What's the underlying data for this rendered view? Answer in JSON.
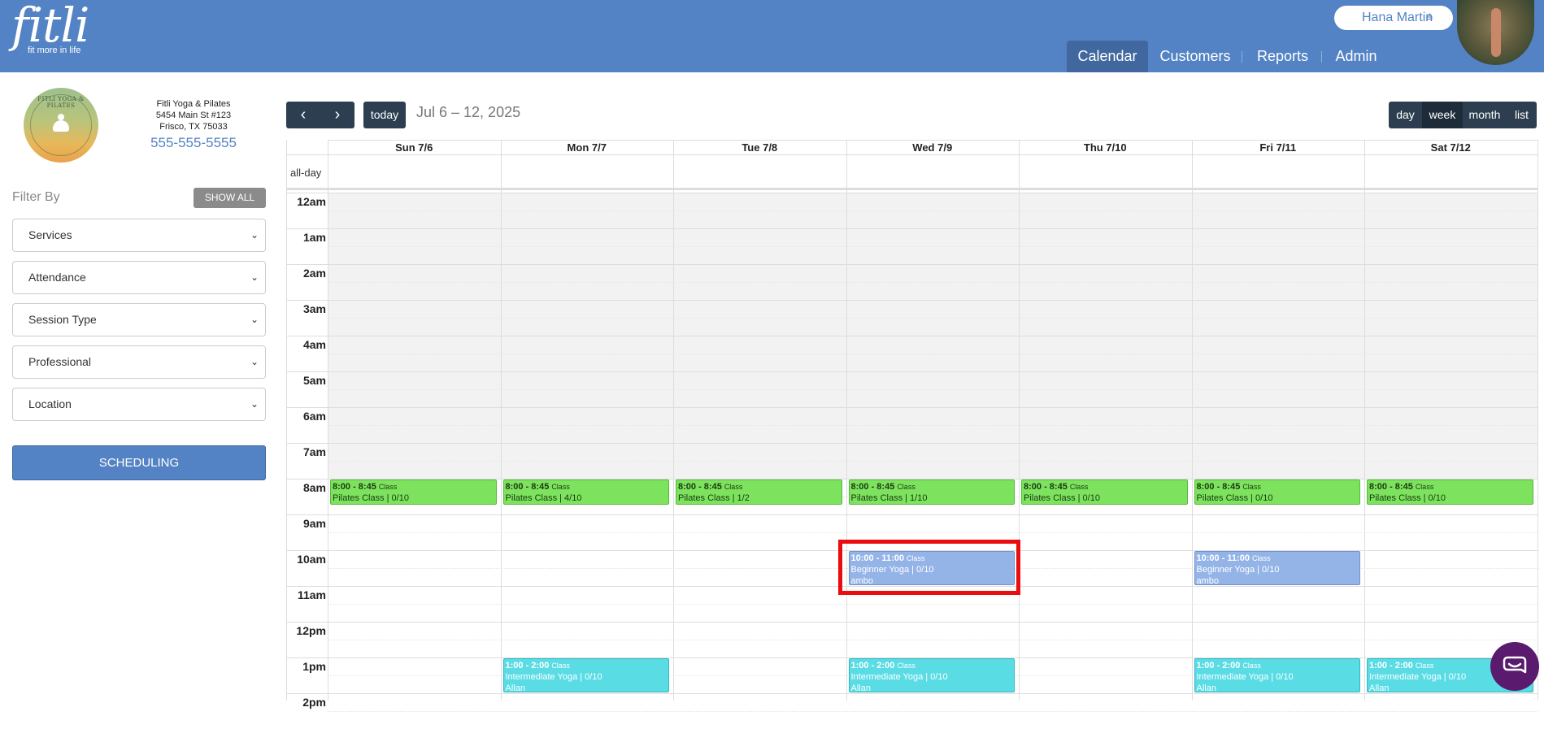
{
  "header": {
    "logo_word": "fitli",
    "logo_tagline": "fit more in life",
    "user_name": "Hana Martin",
    "nav": [
      "Calendar",
      "Customers",
      "Reports",
      "Admin"
    ]
  },
  "business": {
    "logo_text": "FITLI YOGA & PILATES",
    "name": "Fitli Yoga & Pilates",
    "address1": "5454 Main St #123",
    "address2": "Frisco, TX 75033",
    "phone": "555-555-5555"
  },
  "filters": {
    "label": "Filter By",
    "show_all": "SHOW ALL",
    "selects": [
      "Services",
      "Attendance",
      "Session Type",
      "Professional",
      "Location"
    ],
    "scheduling": "SCHEDULING"
  },
  "toolbar": {
    "prev": "‹",
    "next": "›",
    "today": "today",
    "date_range": "Jul 6 – 12, 2025",
    "views": [
      "day",
      "week",
      "month",
      "list"
    ]
  },
  "calendar": {
    "allday_label": "all-day",
    "days": [
      "Sun 7/6",
      "Mon 7/7",
      "Tue 7/8",
      "Wed 7/9",
      "Thu 7/10",
      "Fri 7/11",
      "Sat 7/12"
    ],
    "hours": [
      "12am",
      "1am",
      "2am",
      "3am",
      "4am",
      "5am",
      "6am",
      "7am",
      "8am",
      "9am",
      "10am",
      "11am",
      "12pm",
      "1pm",
      "2pm"
    ],
    "events": [
      {
        "day": 0,
        "color": "green",
        "time": "8:00 - 8:45",
        "type": "Class",
        "title": "Pilates Class | 0/10",
        "who": ""
      },
      {
        "day": 1,
        "color": "green",
        "time": "8:00 - 8:45",
        "type": "Class",
        "title": "Pilates Class | 4/10",
        "who": ""
      },
      {
        "day": 2,
        "color": "green",
        "time": "8:00 - 8:45",
        "type": "Class",
        "title": "Pilates Class | 1/2",
        "who": ""
      },
      {
        "day": 3,
        "color": "green",
        "time": "8:00 - 8:45",
        "type": "Class",
        "title": "Pilates Class | 1/10",
        "who": ""
      },
      {
        "day": 4,
        "color": "green",
        "time": "8:00 - 8:45",
        "type": "Class",
        "title": "Pilates Class | 0/10",
        "who": ""
      },
      {
        "day": 5,
        "color": "green",
        "time": "8:00 - 8:45",
        "type": "Class",
        "title": "Pilates Class | 0/10",
        "who": ""
      },
      {
        "day": 6,
        "color": "green",
        "time": "8:00 - 8:45",
        "type": "Class",
        "title": "Pilates Class | 0/10",
        "who": ""
      },
      {
        "day": 3,
        "color": "blue",
        "time": "10:00 - 11:00",
        "type": "Class",
        "title": "Beginner Yoga | 0/10",
        "who": "ambo"
      },
      {
        "day": 5,
        "color": "blue",
        "time": "10:00 - 11:00",
        "type": "Class",
        "title": "Beginner Yoga | 0/10",
        "who": "ambo"
      },
      {
        "day": 1,
        "color": "cyan",
        "time": "1:00 - 2:00",
        "type": "Class",
        "title": "Intermediate Yoga | 0/10",
        "who": "Allan"
      },
      {
        "day": 3,
        "color": "cyan",
        "time": "1:00 - 2:00",
        "type": "Class",
        "title": "Intermediate Yoga | 0/10",
        "who": "Allan"
      },
      {
        "day": 5,
        "color": "cyan",
        "time": "1:00 - 2:00",
        "type": "Class",
        "title": "Intermediate Yoga | 0/10",
        "who": "Allan"
      },
      {
        "day": 6,
        "color": "cyan",
        "time": "1:00 - 2:00",
        "type": "Class",
        "title": "Intermediate Yoga | 0/10",
        "who": "Allan"
      }
    ]
  },
  "colors": {
    "brand": "#5383c4",
    "nav_active": "#41689e",
    "toolbar": "#2c3e50",
    "event_green": "#7de35e",
    "event_blue": "#94b4e8",
    "event_cyan": "#5adce5",
    "highlight": "#ea0d0d",
    "chat": "#5a1a6e"
  }
}
